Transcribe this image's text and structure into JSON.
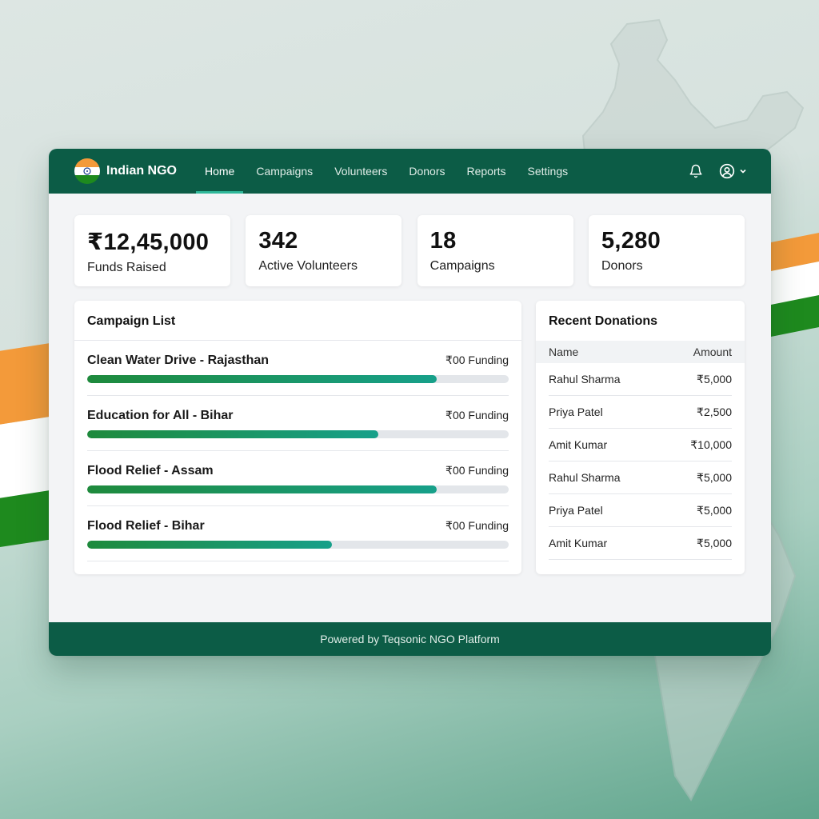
{
  "app": {
    "name": "Indian NGO",
    "logo": "india-flag-emblem"
  },
  "nav": {
    "items": [
      {
        "label": "Home",
        "active": true
      },
      {
        "label": "Campaigns",
        "active": false
      },
      {
        "label": "Volunteers",
        "active": false
      },
      {
        "label": "Donors",
        "active": false
      },
      {
        "label": "Reports",
        "active": false
      },
      {
        "label": "Settings",
        "active": false
      }
    ],
    "icons": {
      "notifications": "bell-icon",
      "account": "user-circle-icon",
      "menu": "chevron-down-icon"
    }
  },
  "stats": [
    {
      "value": "₹12,45,000",
      "label": "Funds Raised"
    },
    {
      "value": "342",
      "label": "Active Volunteers"
    },
    {
      "value": "18",
      "label": "Campaigns"
    },
    {
      "value": "5,280",
      "label": "Donors"
    }
  ],
  "campaigns": {
    "title": "Campaign List",
    "items": [
      {
        "name": "Clean Water Drive - Rajasthan",
        "funding": "₹00 Funding",
        "progress": 0.83
      },
      {
        "name": "Education for All - Bihar",
        "funding": "₹00 Funding",
        "progress": 0.69
      },
      {
        "name": "Flood Relief - Assam",
        "funding": "₹00 Funding",
        "progress": 0.83
      },
      {
        "name": "Flood Relief - Bihar",
        "funding": "₹00 Funding",
        "progress": 0.58
      }
    ]
  },
  "donations": {
    "title": "Recent Donations",
    "columns": [
      "Name",
      "Amount"
    ],
    "rows": [
      {
        "name": "Rahul Sharma",
        "amount": "₹5,000"
      },
      {
        "name": "Priya Patel",
        "amount": "₹2,500"
      },
      {
        "name": "Amit Kumar",
        "amount": "₹10,000"
      },
      {
        "name": "Rahul Sharma",
        "amount": "₹5,000"
      },
      {
        "name": "Priya Patel",
        "amount": "₹5,000"
      },
      {
        "name": "Amit Kumar",
        "amount": "₹5,000"
      }
    ]
  },
  "footer": {
    "text": "Powered by Teqsonic NGO Platform"
  },
  "colors": {
    "brand": "#0c5c46",
    "accent": "#2fb89a",
    "saffron": "#f39a3a",
    "green": "#1e8a1e"
  }
}
